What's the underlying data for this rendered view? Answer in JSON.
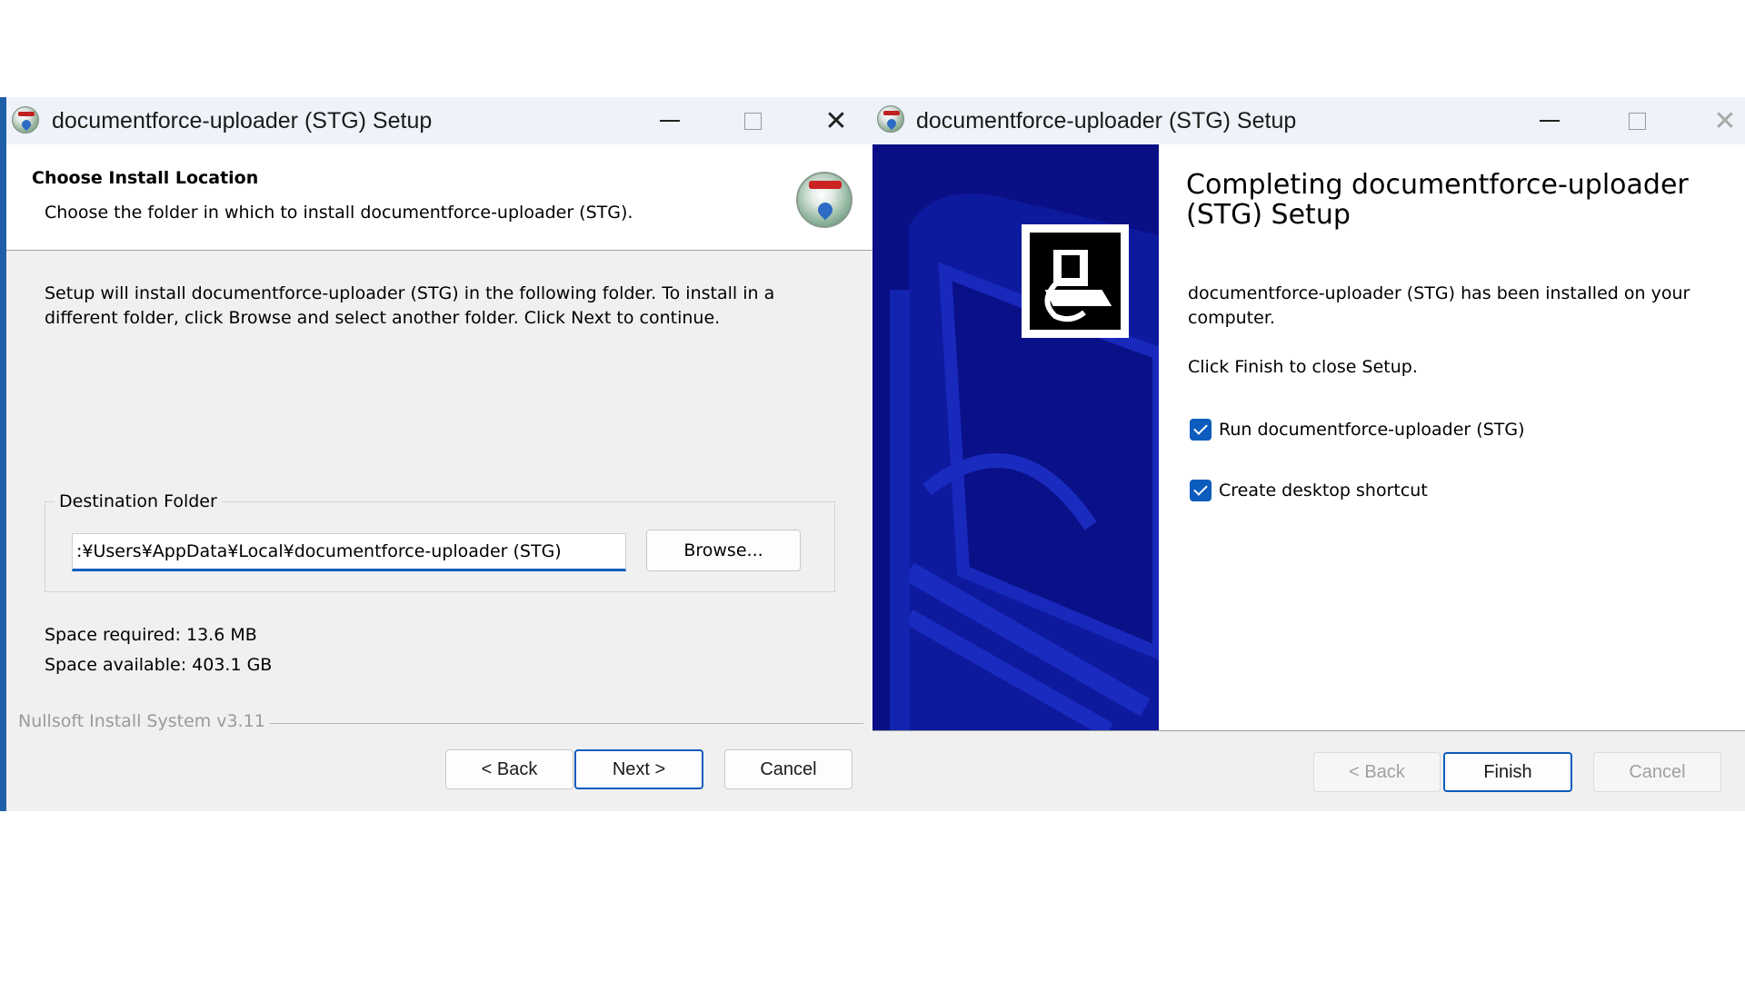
{
  "left_window": {
    "title": "documentforce-uploader (STG) Setup",
    "header_title": "Choose Install Location",
    "header_subtitle": "Choose the folder in which to install documentforce-uploader (STG).",
    "body_text": "Setup will install documentforce-uploader (STG) in the following folder. To install in a different folder, click Browse and select another folder. Click Next to continue.",
    "destination_label": "Destination Folder",
    "destination_path": ":¥Users¥AppData¥Local¥documentforce-uploader (STG)",
    "browse_label": "Browse...",
    "space_required": "Space required: 13.6 MB",
    "space_available": "Space available: 403.1 GB",
    "branding": "Nullsoft Install System v3.11",
    "back_label": "< Back",
    "next_label": "Next >",
    "cancel_label": "Cancel"
  },
  "right_window": {
    "title": "documentforce-uploader (STG) Setup",
    "finish_title": "Completing documentforce-uploader (STG) Setup",
    "finish_text": "documentforce-uploader (STG) has been installed on your computer.",
    "finish_text2": "Click Finish to close Setup.",
    "checkbox_run_label": "Run documentforce-uploader (STG)",
    "checkbox_run_checked": true,
    "checkbox_shortcut_label": "Create desktop shortcut",
    "checkbox_shortcut_checked": true,
    "back_label": "< Back",
    "finish_label": "Finish",
    "cancel_label": "Cancel"
  },
  "colors": {
    "accent": "#0b5cbd",
    "side_art": "#0a0f86"
  }
}
